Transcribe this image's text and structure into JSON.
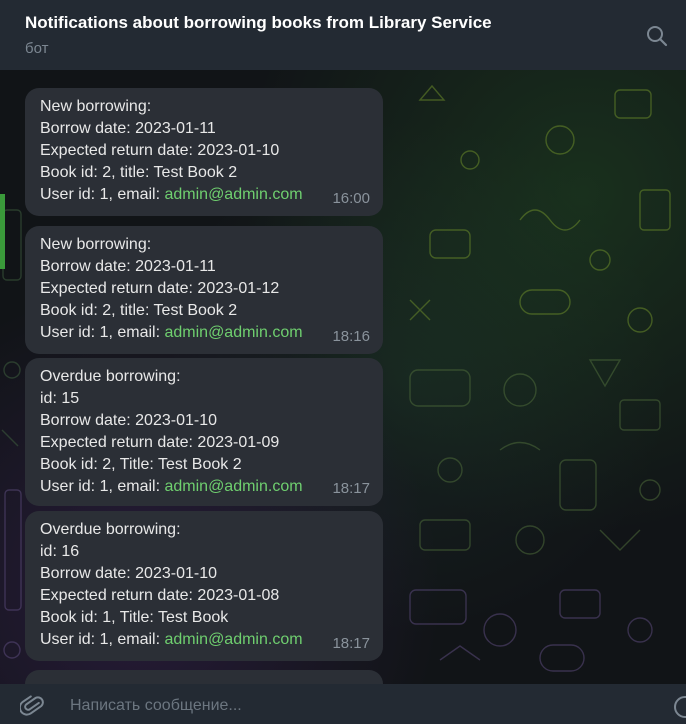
{
  "header": {
    "title": "Notifications about borrowing books from Library Service",
    "subtitle": "бот",
    "search_icon": "search-icon"
  },
  "messages": [
    {
      "lines": [
        "New borrowing:",
        "Borrow date: 2023-01-11",
        "Expected return date: 2023-01-10",
        "Book id: 2, title: Test Book 2"
      ],
      "user_prefix": "User id: 1, email: ",
      "email": "admin@admin.com",
      "time": "16:00"
    },
    {
      "lines": [
        "New borrowing:",
        "Borrow date: 2023-01-11",
        "Expected return date: 2023-01-12",
        "Book id: 2, title: Test Book 2"
      ],
      "user_prefix": "User id: 1, email: ",
      "email": "admin@admin.com",
      "time": "18:16"
    },
    {
      "lines": [
        "Overdue borrowing:",
        "id: 15",
        "Borrow date: 2023-01-10",
        "Expected return date: 2023-01-09",
        "Book id: 2, Title: Test Book 2"
      ],
      "user_prefix": "User id: 1, email: ",
      "email": "admin@admin.com",
      "time": "18:17"
    },
    {
      "lines": [
        "Overdue borrowing:",
        "id: 16",
        "Borrow date: 2023-01-10",
        "Expected return date: 2023-01-08",
        "Book id: 1, Title: Test Book"
      ],
      "user_prefix": "User id: 1, email: ",
      "email": "admin@admin.com",
      "time": "18:17"
    }
  ],
  "composer": {
    "placeholder": "Написать сообщение...",
    "attach_icon": "paperclip-icon",
    "emoji_icon": "emoji-icon"
  },
  "colors": {
    "header_bg": "#232a33",
    "bubble_bg": "#2b2f36",
    "link": "#6fcf6f",
    "time": "#8a939c"
  }
}
